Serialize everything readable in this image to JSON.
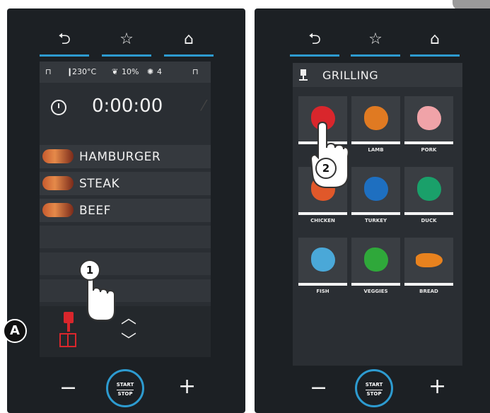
{
  "left_panel": {
    "nav": {
      "back_icon": "back-arrow-icon",
      "favorite_icon": "star-icon",
      "home_icon": "home-icon"
    },
    "status": {
      "temperature": "230°C",
      "humidity": "10%",
      "fan_speed": "4"
    },
    "timer": {
      "value": "0:00:00"
    },
    "foods": [
      {
        "name": "HAMBURGER"
      },
      {
        "name": "STEAK"
      },
      {
        "name": "BEEF"
      }
    ],
    "callout_number": "1",
    "side_label": "A"
  },
  "right_panel": {
    "nav": {
      "back_icon": "back-arrow-icon",
      "favorite_icon": "star-icon",
      "home_icon": "home-icon"
    },
    "title": "GRILLING",
    "categories": [
      {
        "label": "",
        "color": "#d9262c",
        "icon": "beef-icon"
      },
      {
        "label": "LAMB",
        "color": "#e07a22",
        "icon": "lamb-icon"
      },
      {
        "label": "PORK",
        "color": "#f0a3a8",
        "icon": "pork-icon"
      },
      {
        "label": "CHICKEN",
        "color": "#e0582a",
        "icon": "chicken-icon"
      },
      {
        "label": "TURKEY",
        "color": "#1e6fc0",
        "icon": "turkey-icon"
      },
      {
        "label": "DUCK",
        "color": "#1aa06a",
        "icon": "duck-icon"
      },
      {
        "label": "FISH",
        "color": "#4aa8d8",
        "icon": "fish-icon"
      },
      {
        "label": "VEGGIES",
        "color": "#2fa83a",
        "icon": "veggies-icon"
      },
      {
        "label": "BREAD",
        "color": "#e8821e",
        "icon": "bread-icon"
      }
    ],
    "callout_number": "2"
  },
  "controls": {
    "minus": "−",
    "plus": "+",
    "start": "START",
    "stop": "STOP"
  },
  "colors": {
    "accent": "#2d9bd0",
    "mode": "#d9262c"
  }
}
